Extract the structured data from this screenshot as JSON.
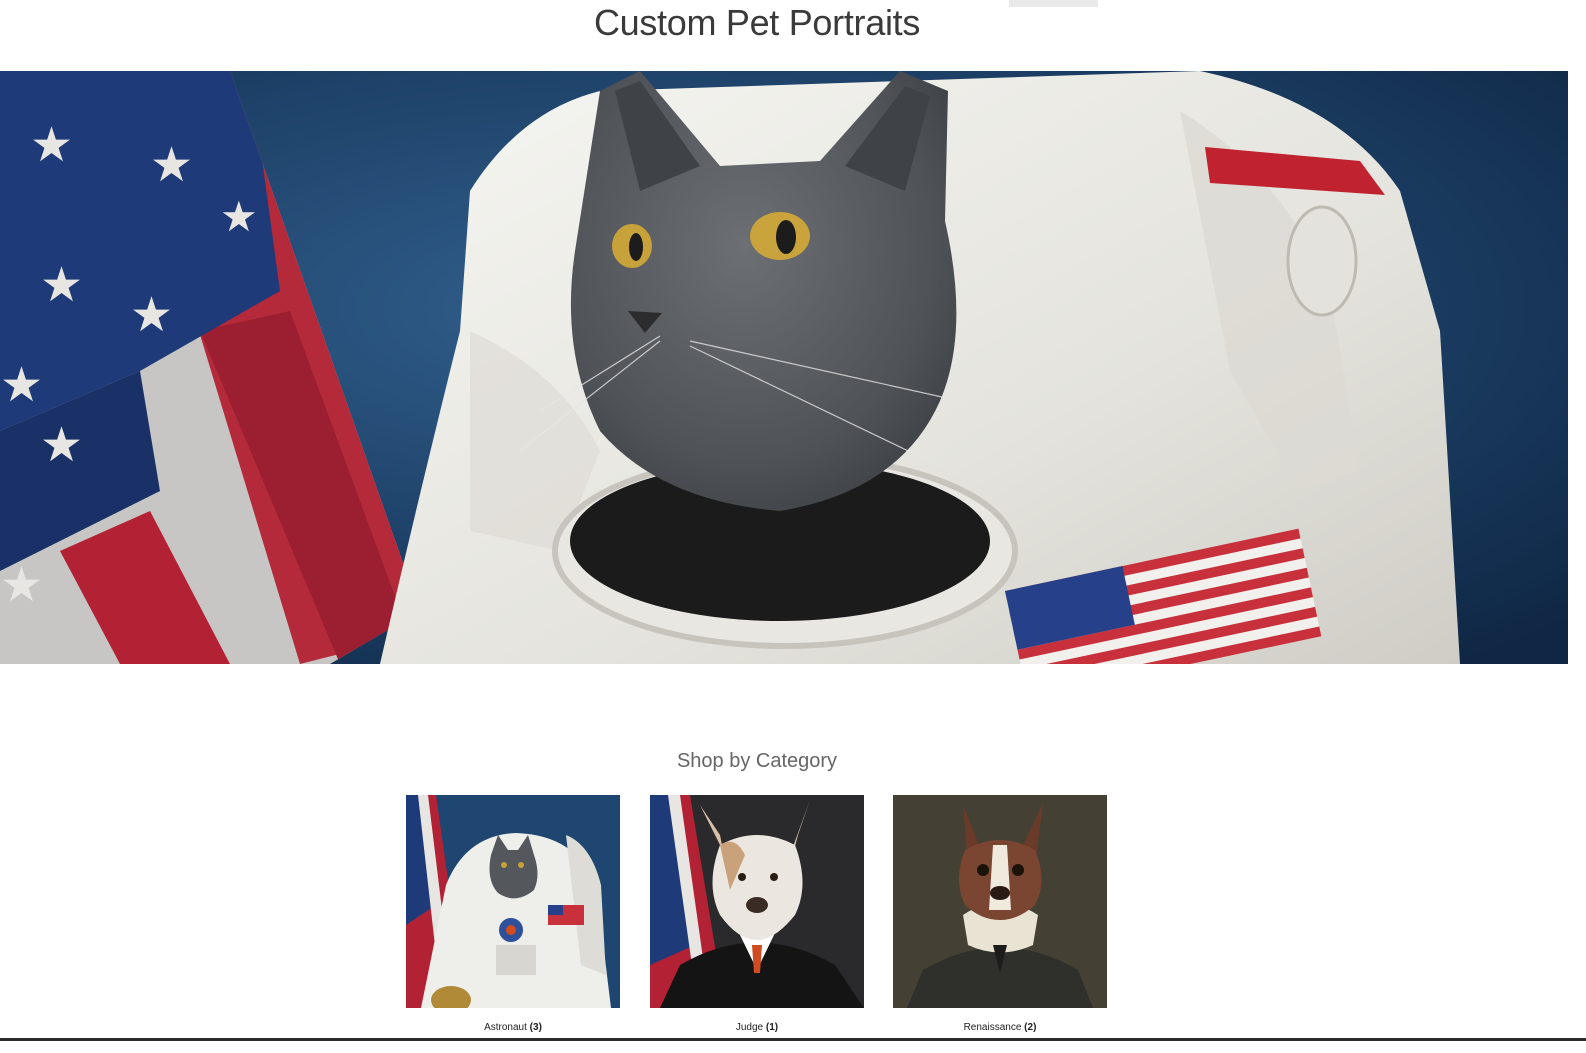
{
  "site": {
    "title": "Custom Pet Portraits"
  },
  "hero": {
    "subject": "cat-astronaut-portrait"
  },
  "categories_section": {
    "title": "Shop by Category",
    "items": [
      {
        "name": "Astronaut",
        "count": "(3)",
        "image": "cat-astronaut-thumbnail"
      },
      {
        "name": "Judge",
        "count": "(1)",
        "image": "dog-judge-thumbnail"
      },
      {
        "name": "Renaissance",
        "count": "(2)",
        "image": "dog-renaissance-thumbnail"
      }
    ]
  },
  "colors": {
    "background": "#ffffff",
    "hero_backdrop": "#1d4068",
    "title_text": "#3a3a3a",
    "flag_red": "#b32234",
    "flag_blue": "#1f3a78",
    "suit_white": "#eeeeea",
    "cat_gray": "#555a5f"
  }
}
